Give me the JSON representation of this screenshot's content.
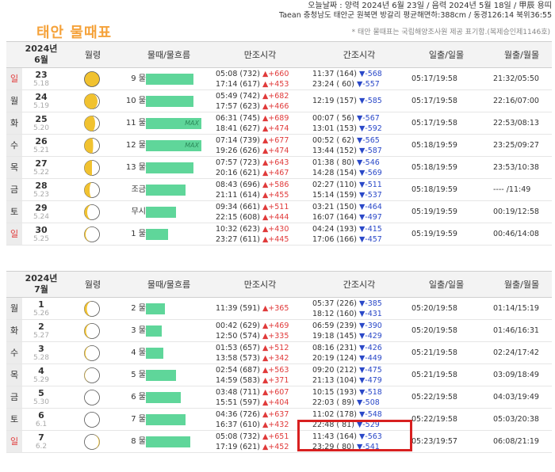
{
  "header": {
    "today_line": "오늘날짜 : 양력 2024년 6월 23일 / 음력 2024년 5월 18일 / 甲辰 용띠",
    "location_line": "Taean 충청남도 태안군 원북면 방갈리 평균해면하:388cm / 동경126:14 북위36:55",
    "title": "태안 물때표",
    "note": "* 태안 물때표는 국립해양조사원 제공 표기함.(복제승인제1146호)"
  },
  "columns": {
    "moon_phase": "월령",
    "tide": "물때/물흐름",
    "high": "만조시각",
    "low": "간조시각",
    "sun": "일출/일몰",
    "moonrise": "월출/월몰"
  },
  "months": [
    {
      "year_month": "2024년\n6월",
      "rows": [
        {
          "wd": "일",
          "sun": true,
          "date": "23",
          "lunar": "5.18",
          "phase": "full",
          "tide": "9 물",
          "bar": 60,
          "max": "",
          "h1": "05:08 (732) ",
          "h1c": "▲+660",
          "h2": "17:14 (617) ",
          "h2c": "▲+453",
          "l1": "11:37 (164) ",
          "l1c": "▼-568",
          "l2": "23:24 ( 60) ",
          "l2c": "▼-557",
          "sun_t": "05:17/19:58",
          "moon_t": "21:32/05:50"
        },
        {
          "wd": "월",
          "sun": false,
          "date": "24",
          "lunar": "5.19",
          "phase": "wane1",
          "tide": "10 물",
          "bar": 60,
          "max": "",
          "h1": "05:49 (742) ",
          "h1c": "▲+682",
          "h2": "17:57 (623) ",
          "h2c": "▲+466",
          "l1": "",
          "l1c": "",
          "l2": "12:19 (157) ",
          "l2c": "▼-585",
          "sun_t": "05:17/19:58",
          "moon_t": "22:16/07:00"
        },
        {
          "wd": "화",
          "sun": false,
          "date": "25",
          "lunar": "5.20",
          "phase": "wane2",
          "tide": "11 물",
          "bar": 70,
          "max": "MAX",
          "h1": "06:31 (745) ",
          "h1c": "▲+689",
          "h2": "18:41 (627) ",
          "h2c": "▲+474",
          "l1": "00:07 ( 56) ",
          "l1c": "▼-567",
          "l2": "13:01 (153) ",
          "l2c": "▼-592",
          "sun_t": "05:17/19:58",
          "moon_t": "22:53/08:13"
        },
        {
          "wd": "수",
          "sun": false,
          "date": "26",
          "lunar": "5.21",
          "phase": "wane3",
          "tide": "12 물",
          "bar": 70,
          "max": "MAX",
          "h1": "07:14 (739) ",
          "h1c": "▲+677",
          "h2": "19:26 (626) ",
          "h2c": "▲+474",
          "l1": "00:52 ( 62) ",
          "l1c": "▼-565",
          "l2": "13:44 (152) ",
          "l2c": "▼-587",
          "sun_t": "05:18/19:59",
          "moon_t": "23:25/09:27"
        },
        {
          "wd": "목",
          "sun": false,
          "date": "27",
          "lunar": "5.22",
          "phase": "wane4",
          "tide": "13 물",
          "bar": 60,
          "max": "",
          "h1": "07:57 (723) ",
          "h1c": "▲+643",
          "h2": "20:16 (621) ",
          "h2c": "▲+467",
          "l1": "01:38 ( 80) ",
          "l1c": "▼-546",
          "l2": "14:28 (154) ",
          "l2c": "▼-569",
          "sun_t": "05:18/19:59",
          "moon_t": "23:53/10:38"
        },
        {
          "wd": "금",
          "sun": false,
          "date": "28",
          "lunar": "5.23",
          "phase": "wane5",
          "tide": "조금",
          "bar": 50,
          "max": "",
          "h1": "08:43 (696) ",
          "h1c": "▲+586",
          "h2": "21:11 (614) ",
          "h2c": "▲+455",
          "l1": "02:27 (110) ",
          "l1c": "▼-511",
          "l2": "15:14 (159) ",
          "l2c": "▼-537",
          "sun_t": "05:18/19:59",
          "moon_t": "---- /11:49"
        },
        {
          "wd": "토",
          "sun": false,
          "date": "29",
          "lunar": "5.24",
          "phase": "wane6",
          "tide": "무시",
          "bar": 38,
          "max": "",
          "h1": "09:34 (661) ",
          "h1c": "▲+511",
          "h2": "22:15 (608) ",
          "h2c": "▲+444",
          "l1": "03:21 (150) ",
          "l1c": "▼-464",
          "l2": "16:07 (164) ",
          "l2c": "▼-497",
          "sun_t": "05:19/19:59",
          "moon_t": "00:19/12:58"
        },
        {
          "wd": "일",
          "sun": true,
          "date": "30",
          "lunar": "5.25",
          "phase": "wane7",
          "tide": "1 물",
          "bar": 28,
          "max": "",
          "h1": "10:32 (623) ",
          "h1c": "▲+430",
          "h2": "23:27 (611) ",
          "h2c": "▲+445",
          "l1": "04:24 (193) ",
          "l1c": "▼-415",
          "l2": "17:06 (166) ",
          "l2c": "▼-457",
          "sun_t": "05:19/19:59",
          "moon_t": "00:46/14:08"
        }
      ]
    },
    {
      "year_month": "2024년\n7월",
      "rows": [
        {
          "wd": "월",
          "sun": false,
          "date": "1",
          "lunar": "5.26",
          "phase": "cres1",
          "tide": "2 물",
          "bar": 24,
          "max": "",
          "h1": "",
          "h1c": "",
          "h2": "11:39 (591) ",
          "h2c": "▲+365",
          "l1": "05:37 (226) ",
          "l1c": "▼-385",
          "l2": "18:12 (160) ",
          "l2c": "▼-431",
          "sun_t": "05:20/19:58",
          "moon_t": "01:14/15:19"
        },
        {
          "wd": "화",
          "sun": false,
          "date": "2",
          "lunar": "5.27",
          "phase": "cres2",
          "tide": "3 물",
          "bar": 20,
          "max": "",
          "h1": "00:42 (629) ",
          "h1c": "▲+469",
          "h2": "12:50 (574) ",
          "h2c": "▲+335",
          "l1": "06:59 (239) ",
          "l1c": "▼-390",
          "l2": "19:18 (145) ",
          "l2c": "▼-429",
          "sun_t": "05:20/19:58",
          "moon_t": "01:46/16:31"
        },
        {
          "wd": "수",
          "sun": false,
          "date": "3",
          "lunar": "5.28",
          "phase": "cres3",
          "tide": "4 물",
          "bar": 22,
          "max": "",
          "h1": "01:53 (657) ",
          "h1c": "▲+512",
          "h2": "13:58 (573) ",
          "h2c": "▲+342",
          "l1": "08:16 (231) ",
          "l1c": "▼-426",
          "l2": "20:19 (124) ",
          "l2c": "▼-449",
          "sun_t": "05:21/19:58",
          "moon_t": "02:24/17:42"
        },
        {
          "wd": "목",
          "sun": false,
          "date": "4",
          "lunar": "5.29",
          "phase": "cres4",
          "tide": "5 물",
          "bar": 38,
          "max": "",
          "h1": "02:54 (687) ",
          "h1c": "▲+563",
          "h2": "14:59 (583) ",
          "h2c": "▲+371",
          "l1": "09:20 (212) ",
          "l1c": "▼-475",
          "l2": "21:13 (104) ",
          "l2c": "▼-479",
          "sun_t": "05:21/19:58",
          "moon_t": "03:09/18:49"
        },
        {
          "wd": "금",
          "sun": false,
          "date": "5",
          "lunar": "5.30",
          "phase": "new",
          "tide": "6 물",
          "bar": 44,
          "max": "",
          "h1": "03:48 (711) ",
          "h1c": "▲+607",
          "h2": "15:51 (597) ",
          "h2c": "▲+404",
          "l1": "10:15 (193) ",
          "l1c": "▼-518",
          "l2": "22:03 ( 89) ",
          "l2c": "▼-508",
          "sun_t": "05:22/19:58",
          "moon_t": "04:03/19:49"
        },
        {
          "wd": "토",
          "sun": false,
          "date": "6",
          "lunar": "6.1",
          "phase": "new",
          "tide": "7 물",
          "bar": 50,
          "max": "",
          "h1": "04:36 (726) ",
          "h1c": "▲+637",
          "h2": "16:37 (610) ",
          "h2c": "▲+432",
          "l1": "11:02 (178) ",
          "l1c": "▼-548",
          "l2": "22:48 ( 81) ",
          "l2c": "▼-529",
          "sun_t": "05:22/19:58",
          "moon_t": "05:03/20:38"
        },
        {
          "wd": "일",
          "sun": true,
          "date": "7",
          "lunar": "6.2",
          "phase": "young",
          "tide": "8 물",
          "bar": 56,
          "max": "",
          "h1": "05:08 (732) ",
          "h1c": "▲+651",
          "h2": "17:19 (621) ",
          "h2c": "▲+452",
          "l1": "11:43 (164) ",
          "l1c": "▼-563",
          "l2": "23:29 ( 80) ",
          "l2c": "▼-541",
          "sun_t": "05:23/19:57",
          "moon_t": "06:08/21:19"
        }
      ]
    }
  ]
}
